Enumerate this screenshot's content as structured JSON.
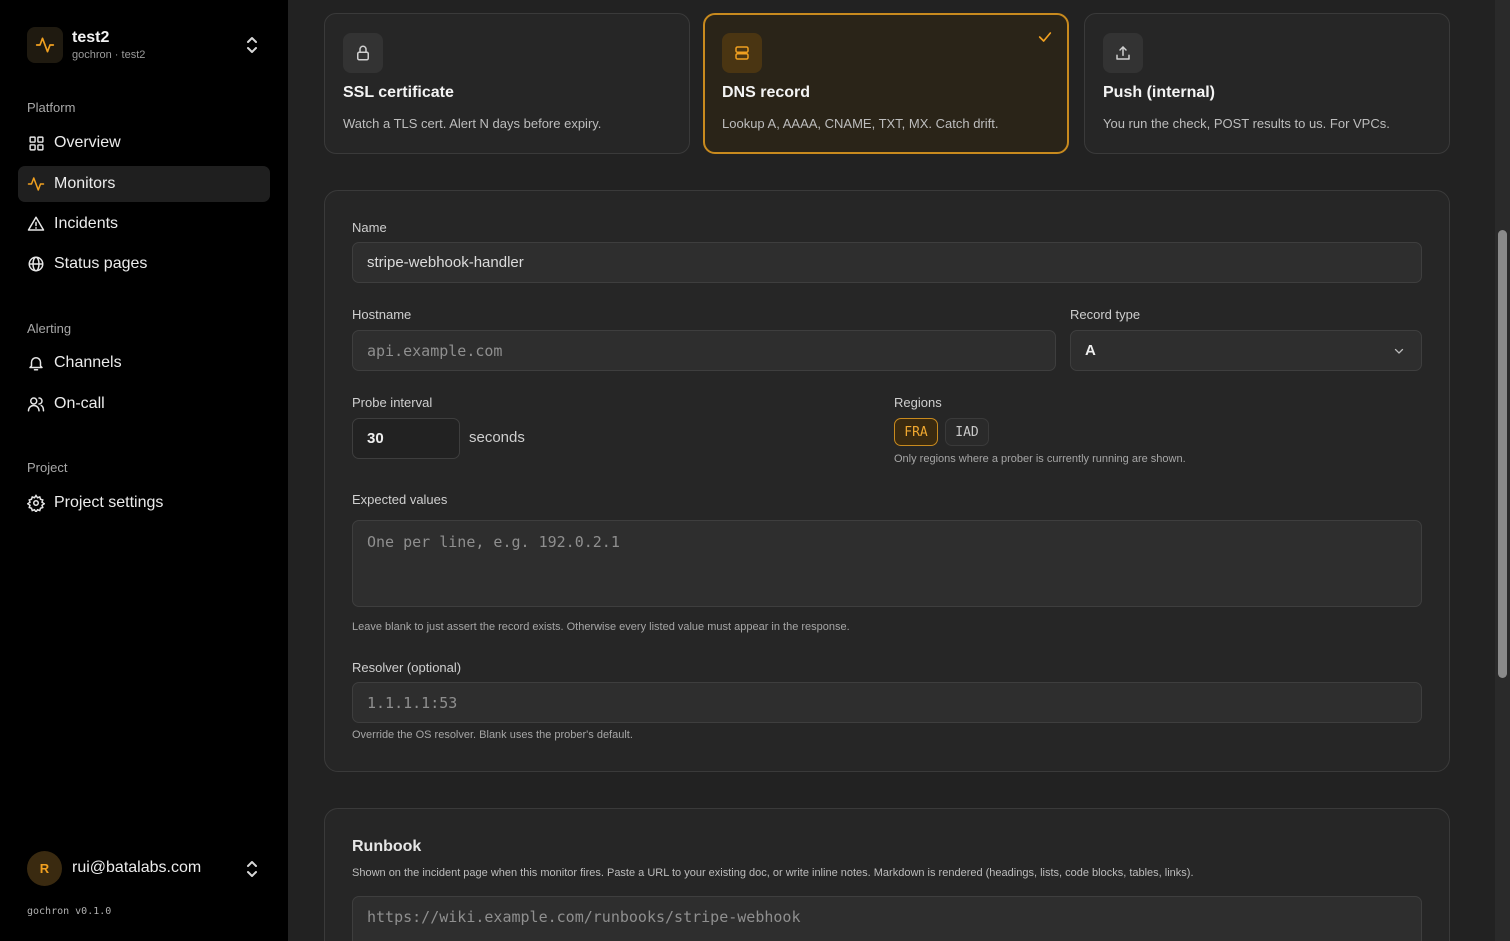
{
  "project": {
    "name": "test2",
    "subtitle": "gochron · test2"
  },
  "sidebar": {
    "sections": [
      {
        "label": "Platform"
      },
      {
        "label": "Alerting"
      },
      {
        "label": "Project"
      }
    ],
    "items": [
      {
        "label": "Overview",
        "icon": "grid-icon"
      },
      {
        "label": "Monitors",
        "icon": "activity-icon",
        "active": true
      },
      {
        "label": "Incidents",
        "icon": "warning-triangle-icon"
      },
      {
        "label": "Status pages",
        "icon": "globe-icon"
      },
      {
        "label": "Channels",
        "icon": "bell-icon"
      },
      {
        "label": "On-call",
        "icon": "users-icon"
      },
      {
        "label": "Project settings",
        "icon": "gear-icon"
      }
    ],
    "user": {
      "initial": "R",
      "email": "rui@batalabs.com"
    },
    "version": "gochron v0.1.0"
  },
  "monitor_types": [
    {
      "title": "SSL certificate",
      "desc": "Watch a TLS cert. Alert N days before expiry.",
      "icon": "lock-icon",
      "selected": false
    },
    {
      "title": "DNS record",
      "desc": "Lookup A, AAAA, CNAME, TXT, MX. Catch drift.",
      "icon": "server-icon",
      "selected": true
    },
    {
      "title": "Push (internal)",
      "desc": "You run the check, POST results to us. For VPCs.",
      "icon": "upload-icon",
      "selected": false
    }
  ],
  "form": {
    "name_label": "Name",
    "name_value": "stripe-webhook-handler",
    "hostname_label": "Hostname",
    "hostname_placeholder": "api.example.com",
    "record_type_label": "Record type",
    "record_type_value": "A",
    "probe_interval_label": "Probe interval",
    "probe_interval_value": "30",
    "probe_interval_unit": "seconds",
    "regions_label": "Regions",
    "regions": [
      {
        "code": "FRA",
        "selected": true
      },
      {
        "code": "IAD",
        "selected": false
      }
    ],
    "regions_hint": "Only regions where a prober is currently running are shown.",
    "expected_label": "Expected values",
    "expected_placeholder": "One per line, e.g. 192.0.2.1",
    "expected_hint": "Leave blank to just assert the record exists. Otherwise every listed value must appear in the response.",
    "resolver_label": "Resolver (optional)",
    "resolver_placeholder": "1.1.1.1:53",
    "resolver_hint": "Override the OS resolver. Blank uses the prober's default."
  },
  "runbook": {
    "title": "Runbook",
    "desc": "Shown on the incident page when this monitor fires. Paste a URL to your existing doc, or write inline notes. Markdown is rendered (headings, lists, code blocks, tables, links).",
    "placeholder": "https://wiki.example.com/runbooks/stripe-webhook"
  },
  "colors": {
    "accent": "#f0a020",
    "accent_border": "#c88a1e"
  }
}
